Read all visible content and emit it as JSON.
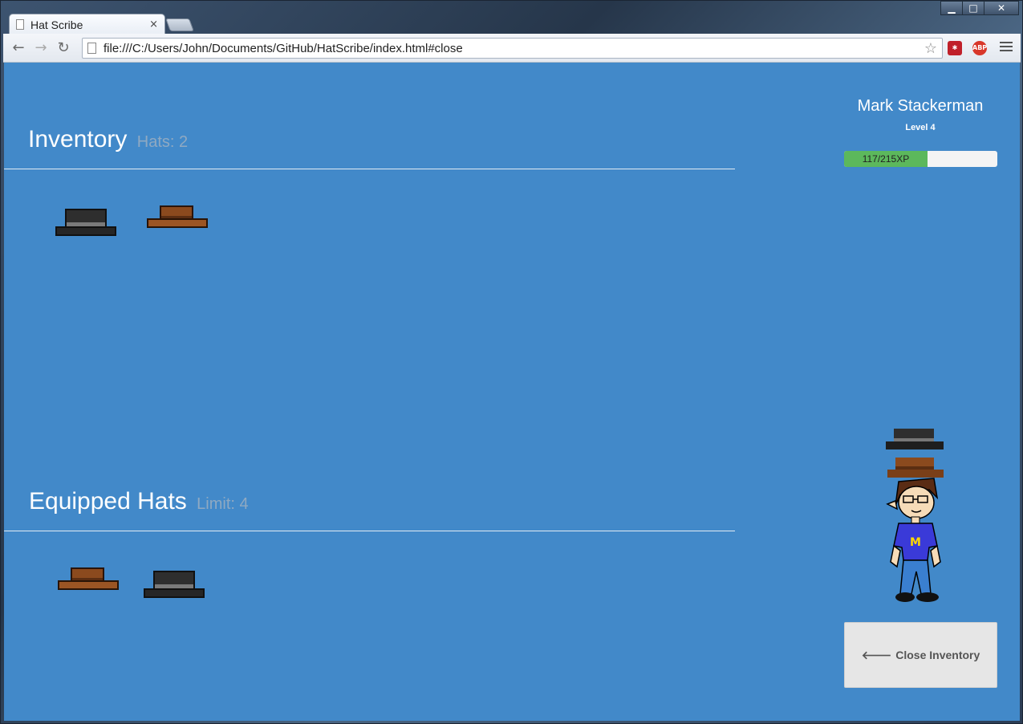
{
  "browser": {
    "tab_title": "Hat Scribe",
    "tab_close": "×",
    "url": "file:///C:/Users/John/Documents/GitHub/HatScribe/index.html#close",
    "window_controls": {
      "minimize": "▁",
      "maximize": "□",
      "close": "✕"
    },
    "extensions": [
      {
        "name": "lastpass-icon",
        "label": "✱",
        "color": "#c0202a"
      },
      {
        "name": "adblock-plus-icon",
        "label": "ABP",
        "color": "#d8372a"
      }
    ]
  },
  "inventory": {
    "title": "Inventory",
    "count_label": "Hats: 2",
    "hats": [
      {
        "name": "black-hat",
        "color": "#2e2e2e",
        "band": "#7a7a7a"
      },
      {
        "name": "brown-hat",
        "color": "#8b4a1e",
        "band": "#5b2e12"
      }
    ]
  },
  "equipped": {
    "title": "Equipped Hats",
    "limit_label": "Limit: 4",
    "hats": [
      {
        "name": "brown-hat",
        "color": "#8b4a1e",
        "band": "#5b2e12"
      },
      {
        "name": "black-hat",
        "color": "#2e2e2e",
        "band": "#7a7a7a"
      }
    ]
  },
  "profile": {
    "name": "Mark Stackerman",
    "level": "Level 4",
    "xp_label": "117/215XP",
    "xp_current": 117,
    "xp_max": 215
  },
  "close_button": {
    "label": "Close Inventory",
    "icon": "arrow-left-icon"
  },
  "colors": {
    "page_bg": "#4289c9",
    "xp_fill": "#5cb85c",
    "subtitle": "#8fa9c2"
  }
}
